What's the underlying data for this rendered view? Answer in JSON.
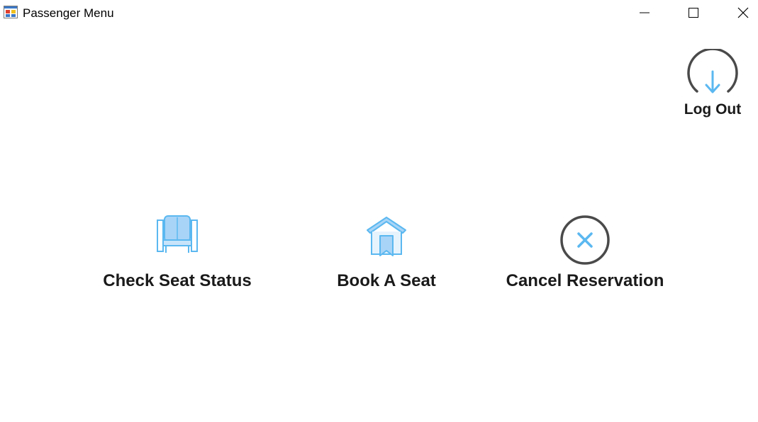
{
  "window": {
    "title": "Passenger Menu",
    "icon": "form-app-icon",
    "controls": [
      "minimize-icon",
      "maximize-icon",
      "close-icon"
    ]
  },
  "logout": {
    "label": "Log Out",
    "icon": "power-logout-icon"
  },
  "menu": {
    "check_seat_status": {
      "label": "Check Seat Status",
      "icon": "seat-icon"
    },
    "book_a_seat": {
      "label": "Book A Seat",
      "icon": "house-bookmark-icon"
    },
    "cancel_reservation": {
      "label": "Cancel Reservation",
      "icon": "cancel-x-circle-icon"
    }
  },
  "colors": {
    "accent_blue": "#5bb8f0",
    "light_blue": "#a8d4f7",
    "icon_gray": "#4a4a4a",
    "text": "#1a1a1a"
  }
}
